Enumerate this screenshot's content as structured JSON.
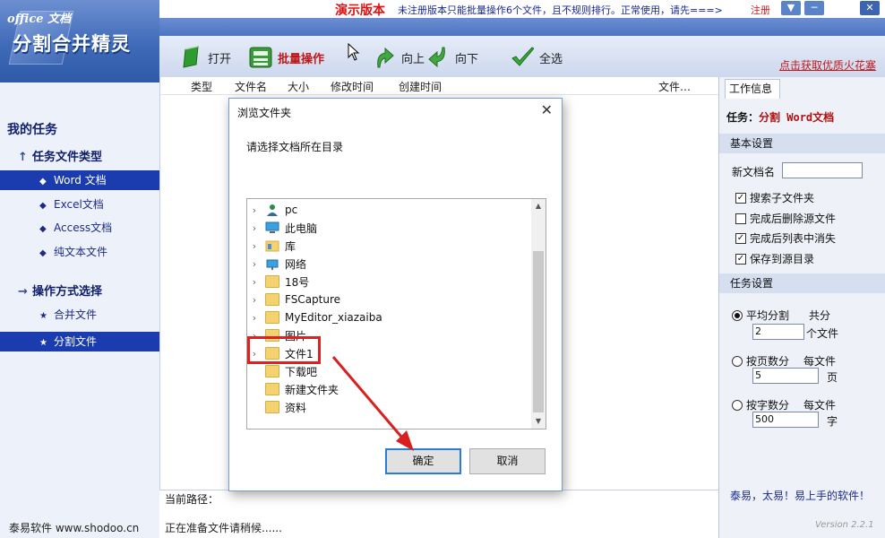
{
  "titlebar": {
    "demo_label": "演示版本",
    "demo_message": "未注册版本只能批量操作6个文件，且不规则排行。正常使用，请先===>",
    "register_link": "注册",
    "menu_btn": "▼",
    "min_btn": "─",
    "close_btn": "✕"
  },
  "logo": {
    "small": "office 文档",
    "big": "分割合并精灵"
  },
  "toolbar": {
    "open": "打开",
    "batch": "批量操作",
    "up": "向上",
    "down": "向下",
    "select_all": "全选",
    "promo": "点击获取优质火花塞"
  },
  "sidebar": {
    "title": "我的任务",
    "cat1": "任务文件类型",
    "types": [
      "Word 文档",
      "Excel文档",
      "Access文档",
      "纯文本文件"
    ],
    "cat2": "操作方式选择",
    "modes": [
      "合并文件",
      "分割文件"
    ],
    "footer": "泰易软件 www.shodoo.cn"
  },
  "filelist": {
    "columns": [
      "类型",
      "文件名",
      "大小",
      "修改时间",
      "创建时间",
      "文件…"
    ],
    "path_label": "当前路径：",
    "status": "正在准备文件请稍候......"
  },
  "right_panel": {
    "tab": "工作信息",
    "task_prefix": "任务：",
    "task_name": "分割 Word文档",
    "basic_title": "基本设置",
    "new_doc_label": "新文档名",
    "new_doc_value": "",
    "checkboxes": [
      {
        "label": "搜索子文件夹",
        "checked": true
      },
      {
        "label": "完成后删除源文件",
        "checked": false
      },
      {
        "label": "完成后列表中消失",
        "checked": true
      },
      {
        "label": "保存到源目录",
        "checked": true
      }
    ],
    "task_title": "任务设置",
    "radio1": "平均分割",
    "radio1_suffix": "共分",
    "radio1_value": "2",
    "radio1_unit": "个文件",
    "radio2": "按页数分",
    "radio2_suffix": "每文件",
    "radio2_value": "5",
    "radio2_unit": "页",
    "radio3": "按字数分",
    "radio3_suffix": "每文件",
    "radio3_value": "500",
    "radio3_unit": "字",
    "footer": "泰易，太易！易上手的软件！",
    "version": "Version 2.2.1"
  },
  "dialog": {
    "title": "浏览文件夹",
    "prompt": "请选择文档所在目录",
    "items": [
      "pc",
      "此电脑",
      "库",
      "网络",
      "18号",
      "FSCapture",
      "MyEditor_xiazaiba",
      "图片",
      "文件1",
      "下载吧",
      "新建文件夹",
      "资料"
    ],
    "ok": "确定",
    "cancel": "取消"
  },
  "colors": {
    "accent": "#1b3caf",
    "demo_red": "#e01010",
    "highlight": "#e02020"
  }
}
